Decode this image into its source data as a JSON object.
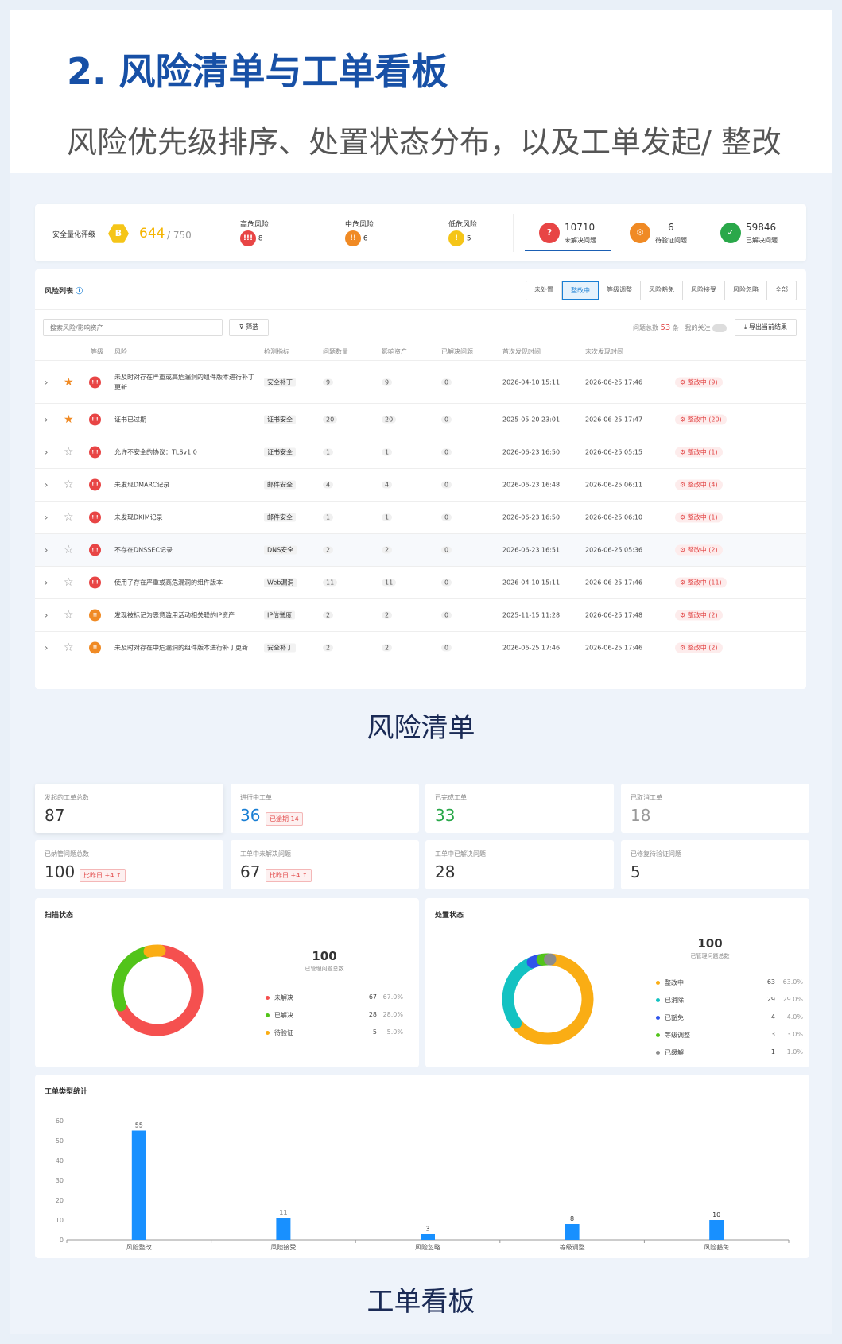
{
  "header": {
    "title": "2. 风险清单与工单看板",
    "subtitle": "风险优先级排序、处置状态分布，以及工单发起/ 整改"
  },
  "score": {
    "label": "安全量化评级",
    "grade": "B",
    "value": "644",
    "max": "/ 750",
    "high": {
      "label": "高危风险",
      "count": "8"
    },
    "mid": {
      "label": "中危风险",
      "count": "6"
    },
    "low": {
      "label": "低危风险",
      "count": "5"
    },
    "unresolved": {
      "count": "10710",
      "label": "未解决问题"
    },
    "pending": {
      "count": "6",
      "label": "待验证问题"
    },
    "resolved": {
      "count": "59846",
      "label": "已解决问题"
    }
  },
  "risk_list": {
    "title": "风险列表",
    "tabs": [
      "未处置",
      "整改中",
      "等级调整",
      "风险豁免",
      "风险接受",
      "风险忽略",
      "全部"
    ],
    "search_placeholder": "搜索风险/影响资产",
    "filter_label": "筛选",
    "total_label": "问题总数",
    "total_count": "53",
    "total_unit": "条",
    "follow_label": "我的关注",
    "export_label": "导出当前结果",
    "columns": [
      "等级",
      "风险",
      "检测指标",
      "问题数量",
      "影响资产",
      "已解决问题",
      "首次发现时间",
      "末次发现时间"
    ],
    "rows": [
      {
        "star": true,
        "level": "high",
        "risk": "未及时对存在严重或高危漏洞的组件版本进行补丁",
        "risk2": "更新",
        "tag": "安全补丁",
        "issues": "9",
        "assets": "9",
        "resolved": "0",
        "first": "2026-04-10 15:11",
        "last": "2026-06-25 17:46",
        "status": "整改中 (9)"
      },
      {
        "star": true,
        "level": "high",
        "risk": "证书已过期",
        "risk2": "",
        "tag": "证书安全",
        "issues": "20",
        "assets": "20",
        "resolved": "0",
        "first": "2025-05-20 23:01",
        "last": "2026-06-25 17:47",
        "status": "整改中 (20)"
      },
      {
        "star": false,
        "level": "high",
        "risk": "允许不安全的协议：TLSv1.0",
        "risk2": "",
        "tag": "证书安全",
        "issues": "1",
        "assets": "1",
        "resolved": "0",
        "first": "2026-06-23 16:50",
        "last": "2026-06-25 05:15",
        "status": "整改中 (1)"
      },
      {
        "star": false,
        "level": "high",
        "risk": "未发现DMARC记录",
        "risk2": "",
        "tag": "邮件安全",
        "issues": "4",
        "assets": "4",
        "resolved": "0",
        "first": "2026-06-23 16:48",
        "last": "2026-06-25 06:11",
        "status": "整改中 (4)"
      },
      {
        "star": false,
        "level": "high",
        "risk": "未发现DKIM记录",
        "risk2": "",
        "tag": "邮件安全",
        "issues": "1",
        "assets": "1",
        "resolved": "0",
        "first": "2026-06-23 16:50",
        "last": "2026-06-25 06:10",
        "status": "整改中 (1)"
      },
      {
        "star": false,
        "level": "high",
        "risk": "不存在DNSSEC记录",
        "risk2": "",
        "tag": "DNS安全",
        "issues": "2",
        "assets": "2",
        "resolved": "0",
        "first": "2026-06-23 16:51",
        "last": "2026-06-25 05:36",
        "status": "整改中 (2)"
      },
      {
        "star": false,
        "level": "high",
        "risk": "使用了存在严重或高危漏洞的组件版本",
        "risk2": "",
        "tag": "Web漏洞",
        "issues": "11",
        "assets": "11",
        "resolved": "0",
        "first": "2026-04-10 15:11",
        "last": "2026-06-25 17:46",
        "status": "整改中 (11)"
      },
      {
        "star": false,
        "level": "mid",
        "risk": "发现被标记为恶意滥用活动相关联的IP资产",
        "risk2": "",
        "tag": "IP信誉度",
        "issues": "2",
        "assets": "2",
        "resolved": "0",
        "first": "2025-11-15 11:28",
        "last": "2026-06-25 17:48",
        "status": "整改中 (2)"
      },
      {
        "star": false,
        "level": "mid",
        "risk": "未及时对存在中危漏洞的组件版本进行补丁更新",
        "risk2": "",
        "tag": "安全补丁",
        "issues": "2",
        "assets": "2",
        "resolved": "0",
        "first": "2026-06-25 17:46",
        "last": "2026-06-25 17:46",
        "status": "整改中 (2)"
      }
    ]
  },
  "caption1": "风险清单",
  "stats": [
    {
      "label": "发起的工单总数",
      "value": "87",
      "badge": "",
      "color": "#333333"
    },
    {
      "label": "进行中工单",
      "value": "36",
      "badge": "已逾期 14",
      "color": "#1a7fd4"
    },
    {
      "label": "已完成工单",
      "value": "33",
      "badge": "",
      "color": "#2aa84a"
    },
    {
      "label": "已取消工单",
      "value": "18",
      "badge": "",
      "color": "#999999"
    },
    {
      "label": "已纳管问题总数",
      "value": "100",
      "badge": "比昨日 +4 ↑",
      "color": "#333333"
    },
    {
      "label": "工单中未解决问题",
      "value": "67",
      "badge": "比昨日 +4 ↑",
      "color": "#333333"
    },
    {
      "label": "工单中已解决问题",
      "value": "28",
      "badge": "",
      "color": "#333333"
    },
    {
      "label": "已修复待验证问题",
      "value": "5",
      "badge": "",
      "color": "#333333"
    }
  ],
  "scan_status": {
    "title": "扫描状态",
    "total": "100",
    "total_label": "已管理问题总数",
    "items": [
      {
        "name": "未解决",
        "value": 67,
        "pct": "67.0%",
        "color": "#f5504f"
      },
      {
        "name": "已解决",
        "value": 28,
        "pct": "28.0%",
        "color": "#52c41a"
      },
      {
        "name": "待验证",
        "value": 5,
        "pct": "5.0%",
        "color": "#faad14"
      }
    ]
  },
  "handle_status": {
    "title": "处置状态",
    "total": "100",
    "total_label": "已管理问题总数",
    "items": [
      {
        "name": "整改中",
        "value": 63,
        "pct": "63.0%",
        "color": "#faad14"
      },
      {
        "name": "已消除",
        "value": 29,
        "pct": "29.0%",
        "color": "#13c2c2"
      },
      {
        "name": "已豁免",
        "value": 4,
        "pct": "4.0%",
        "color": "#2f54eb"
      },
      {
        "name": "等级调整",
        "value": 3,
        "pct": "3.0%",
        "color": "#52c41a"
      },
      {
        "name": "已缓解",
        "value": 1,
        "pct": "1.0%",
        "color": "#8c8c8c"
      }
    ]
  },
  "chart_data": {
    "type": "bar",
    "title": "工单类型统计",
    "categories": [
      "风险整改",
      "风险接受",
      "风险忽略",
      "等级调整",
      "风险豁免"
    ],
    "values": [
      55,
      11,
      3,
      8,
      10
    ],
    "ylim": [
      0,
      60
    ],
    "yticks": [
      0,
      10,
      20,
      30,
      40,
      50,
      60
    ],
    "color": "#1890ff"
  },
  "caption2": "工单看板"
}
